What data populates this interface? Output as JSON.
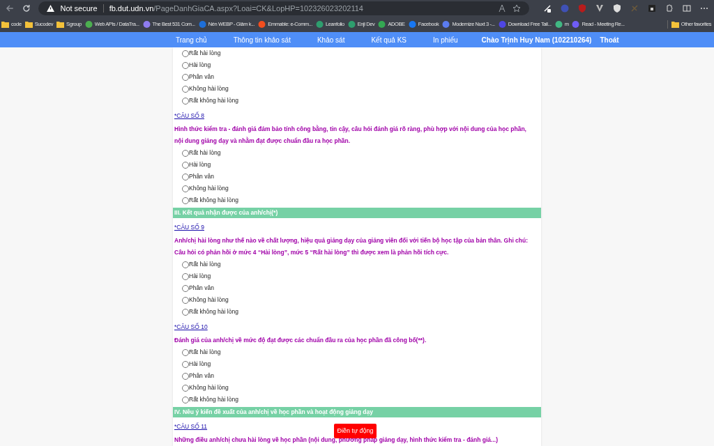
{
  "browser": {
    "security": "Not secure",
    "url_host": "fb.dut.udn.vn",
    "url_path": "/PageDanhGiaCA.aspx?Loai=CK&LopHP=102326023202114",
    "bookmarks": [
      {
        "kind": "folder",
        "label": "code"
      },
      {
        "kind": "folder",
        "label": "Sucodev"
      },
      {
        "kind": "folder",
        "label": "Sgroup"
      },
      {
        "kind": "site",
        "label": "Web APIs / DataTra...",
        "color": "#4caf50"
      },
      {
        "kind": "site",
        "label": "The Best 531 Com...",
        "color": "#8e7cf0"
      },
      {
        "kind": "site",
        "label": "Nén WEBP - Giảm k...",
        "color": "#1e6fd9"
      },
      {
        "kind": "site",
        "label": "Emmable: e-Comm...",
        "color": "#f24e1e"
      },
      {
        "kind": "site",
        "label": "Leanfolio",
        "color": "#2e9e6e"
      },
      {
        "kind": "site",
        "label": "Enji Dev",
        "color": "#2e9e6e"
      },
      {
        "kind": "site",
        "label": "ADOBE",
        "color": "#34a853"
      },
      {
        "kind": "site",
        "label": "Facebook",
        "color": "#1877f2"
      },
      {
        "kind": "site",
        "label": "Modernize Nuxt 3 -...",
        "color": "#5b7cf0"
      },
      {
        "kind": "site",
        "label": "Download Free Tail...",
        "color": "#4f46e5"
      },
      {
        "kind": "site",
        "label": "m",
        "color": "#41b883"
      },
      {
        "kind": "site",
        "label": "Read - Meeting Re...",
        "color": "#6f5cf6"
      }
    ],
    "other_favorites": "Other favorites"
  },
  "nav": {
    "items": [
      "Trang chủ",
      "Thông tin khảo sát",
      "Khảo sát",
      "Kết quả KS",
      "In phiếu"
    ],
    "greeting": "Chào Trịnh Huy Nam (102210264)",
    "logout": "Thoát"
  },
  "blocks": [
    {
      "kind": "options",
      "options": [
        {
          "label": "Rất hài lòng",
          "selected": false
        },
        {
          "label": "Hài lòng",
          "selected": false
        },
        {
          "label": "Phân vân",
          "selected": false
        },
        {
          "label": "Không hài lòng",
          "selected": false
        },
        {
          "label": "Rất không hài lòng",
          "selected": false
        }
      ]
    },
    {
      "kind": "question",
      "number": "*CÂU SỐ 8",
      "text": "Hình thức kiểm tra - đánh giá đảm bảo tính công bằng, tin cậy, câu hỏi đánh giá rõ ràng, phù hợp với nội dung của học phần, nội dung giảng dạy và nhằm đạt được chuẩn đầu ra học phần."
    },
    {
      "kind": "options",
      "options": [
        {
          "label": "Rất hài lòng",
          "selected": false
        },
        {
          "label": "Hài lòng",
          "selected": false
        },
        {
          "label": "Phân vân",
          "selected": false
        },
        {
          "label": "Không hài lòng",
          "selected": false
        },
        {
          "label": "Rất không hài lòng",
          "selected": false
        }
      ]
    },
    {
      "kind": "section",
      "title": "III. Kết quả nhận được của anh/chị(*)"
    },
    {
      "kind": "question",
      "number": "*CÂU SỐ 9",
      "text": "Anh/chị hài lòng như thế nào về chất lượng, hiệu quả giảng dạy của giảng viên đối với tiến bộ học tập của bản thân. Ghi chú: Câu hỏi có phản hồi ở mức 4 “Hài lòng”, mức 5 “Rất hài lòng” thì được xem là phản hồi tích cực."
    },
    {
      "kind": "options",
      "options": [
        {
          "label": "Rất hài lòng",
          "selected": false
        },
        {
          "label": "Hài lòng",
          "selected": false
        },
        {
          "label": "Phân vân",
          "selected": false
        },
        {
          "label": "Không hài lòng",
          "selected": false
        },
        {
          "label": "Rất không hài lòng",
          "selected": false
        }
      ]
    },
    {
      "kind": "question",
      "number": "*CÂU SỐ 10",
      "text": "Đánh giá của anh/chị về mức độ đạt được các chuẩn đầu ra của học phần đã công bố(**)."
    },
    {
      "kind": "options",
      "options": [
        {
          "label": "Rất hài lòng",
          "selected": false
        },
        {
          "label": "Hài lòng",
          "selected": false
        },
        {
          "label": "Phân vân",
          "selected": false
        },
        {
          "label": "Không hài lòng",
          "selected": false
        },
        {
          "label": "Rất không hài lòng",
          "selected": false
        }
      ]
    },
    {
      "kind": "section",
      "title": "IV. Nêu ý kiến đề xuất của anh/chị về học phần và hoạt động giảng dạy"
    },
    {
      "kind": "question",
      "number": "*CÂU SỐ 11",
      "text": "Những điều anh/chị chưa hài lòng về học phần (nội dung, phương pháp giảng dạy, hình thức kiểm tra - đánh giá...)"
    }
  ],
  "autofill_button": "Điền tự động"
}
